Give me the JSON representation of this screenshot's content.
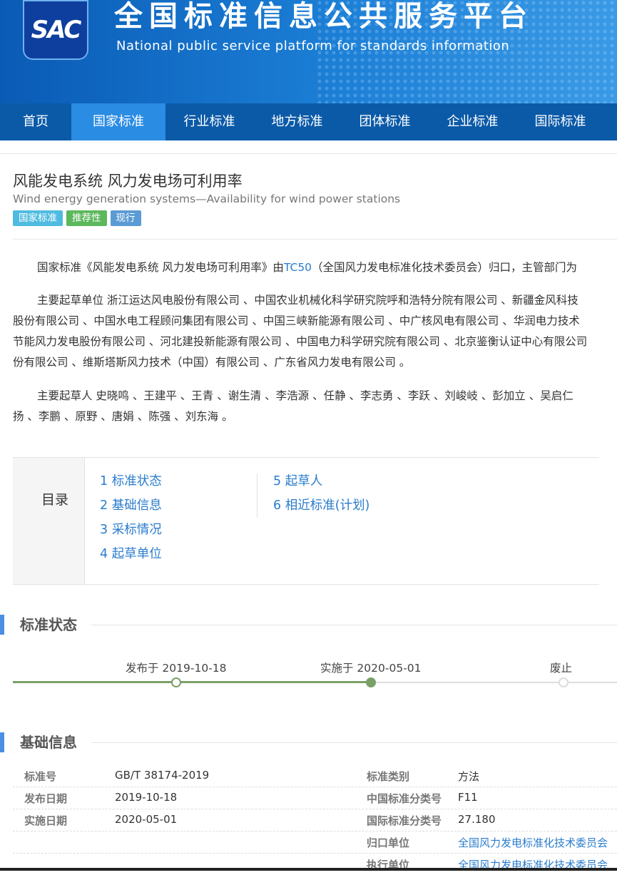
{
  "header": {
    "logo_text": "SAC",
    "title_cn": "全国标准信息公共服务平台",
    "title_en": "National public service platform  for standards information"
  },
  "nav": [
    "首页",
    "国家标准",
    "行业标准",
    "地方标准",
    "团体标准",
    "企业标准",
    "国际标准"
  ],
  "standard": {
    "title_cn": "风能发电系统 风力发电场可利用率",
    "title_en": "Wind energy generation systems—Availability for wind power stations",
    "tags": [
      "国家标准",
      "推荐性",
      "现行"
    ]
  },
  "intro": {
    "p1_a": "国家标准《风能发电系统 风力发电场可利用率》由",
    "p1_link": "TC50",
    "p1_b": "（全国风力发电标准化技术委员会）归口，主管部门为",
    "p2_l1": "主要起草单位 浙江运达风电股份有限公司 、中国农业机械化科学研究院呼和浩特分院有限公司 、新疆金风科技",
    "p2_l2": "股份有限公司 、中国水电工程顾问集团有限公司 、中国三峡新能源有限公司 、中广核风电有限公司 、华润电力技术",
    "p2_l3": "节能风力发电股份有限公司 、河北建投新能源有限公司 、中国电力科学研究院有限公司 、北京鉴衡认证中心有限公司",
    "p2_l4": "份有限公司 、维斯塔斯风力技术（中国）有限公司 、广东省风力发电有限公司 。",
    "p3_l1": "主要起草人 史晓鸣 、王建平 、王青 、谢生清 、李浩源 、任静 、李志勇 、李跃 、刘峻岐 、彭加立 、吴启仁",
    "p3_l2": "扬 、李鹏 、原野 、唐娟 、陈强 、刘东海 。"
  },
  "toc": {
    "label": "目录",
    "col1": [
      "1  标准状态",
      "2  基础信息",
      "3  采标情况",
      "4  起草单位"
    ],
    "col2": [
      "5  起草人",
      "6  相近标准(计划)"
    ]
  },
  "status": {
    "section_title": "标准状态",
    "published": "发布于 2019-10-18",
    "implemented": "实施于 2020-05-01",
    "abolished": "废止"
  },
  "basic": {
    "section_title": "基础信息",
    "rows": [
      {
        "k1": "标准号",
        "v1": "GB/T 38174-2019",
        "k2": "标准类别",
        "v2": "方法"
      },
      {
        "k1": "发布日期",
        "v1": "2019-10-18",
        "k2": "中国标准分类号",
        "v2": "F11"
      },
      {
        "k1": "实施日期",
        "v1": "2020-05-01",
        "k2": "国际标准分类号",
        "v2": "27.180"
      },
      {
        "k1": "",
        "v1": "",
        "k2": "归口单位",
        "v2": "全国风力发电标准化技术委员会"
      },
      {
        "k1": "",
        "v1": "",
        "k2": "执行单位",
        "v2": "全国风力发电标准化技术委员会"
      }
    ]
  }
}
